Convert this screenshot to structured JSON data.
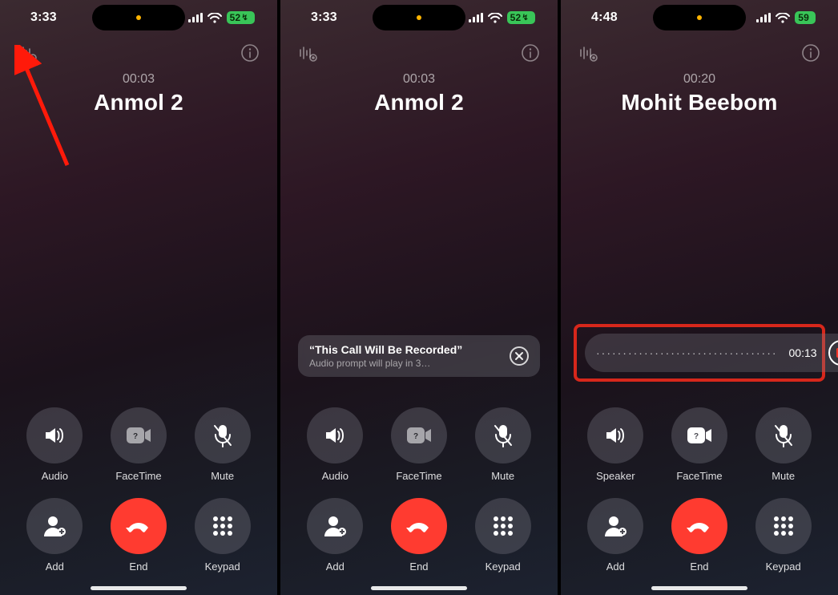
{
  "screens": [
    {
      "status": {
        "time": "3:33",
        "battery": "52"
      },
      "call": {
        "duration": "00:03",
        "name": "Anmol 2"
      },
      "controls": [
        {
          "label": "Audio",
          "icon": "speaker"
        },
        {
          "label": "FaceTime",
          "icon": "facetime"
        },
        {
          "label": "Mute",
          "icon": "mute"
        },
        {
          "label": "Add",
          "icon": "add"
        },
        {
          "label": "End",
          "icon": "end"
        },
        {
          "label": "Keypad",
          "icon": "keypad"
        }
      ]
    },
    {
      "status": {
        "time": "3:33",
        "battery": "52"
      },
      "call": {
        "duration": "00:03",
        "name": "Anmol 2"
      },
      "prompt": {
        "title": "“This Call Will Be Recorded”",
        "subtitle": "Audio prompt will play in 3…"
      },
      "controls": [
        {
          "label": "Audio",
          "icon": "speaker"
        },
        {
          "label": "FaceTime",
          "icon": "facetime"
        },
        {
          "label": "Mute",
          "icon": "mute"
        },
        {
          "label": "Add",
          "icon": "add"
        },
        {
          "label": "End",
          "icon": "end"
        },
        {
          "label": "Keypad",
          "icon": "keypad"
        }
      ]
    },
    {
      "status": {
        "time": "4:48",
        "battery": "59"
      },
      "call": {
        "duration": "00:20",
        "name": "Mohit Beebom"
      },
      "recording": {
        "elapsed": "00:13",
        "wave": "··································"
      },
      "controls": [
        {
          "label": "Speaker",
          "icon": "speaker"
        },
        {
          "label": "FaceTime",
          "icon": "facetime"
        },
        {
          "label": "Mute",
          "icon": "mute"
        },
        {
          "label": "Add",
          "icon": "add"
        },
        {
          "label": "End",
          "icon": "end"
        },
        {
          "label": "Keypad",
          "icon": "keypad"
        }
      ]
    }
  ]
}
